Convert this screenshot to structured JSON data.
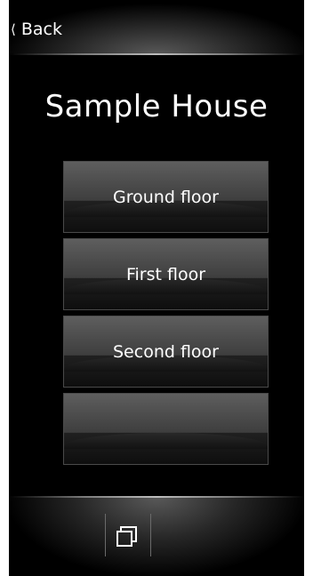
{
  "header": {
    "back_label": "Back"
  },
  "page": {
    "title": "Sample House"
  },
  "floors": [
    {
      "label": "Ground floor"
    },
    {
      "label": "First floor"
    },
    {
      "label": "Second floor"
    },
    {
      "label": ""
    }
  ],
  "footer": {
    "icon": "windows-icon"
  },
  "colors": {
    "background": "#000000",
    "text": "#ffffff",
    "button_top": "#5e5e5e",
    "button_bottom": "#0e0e0e"
  }
}
